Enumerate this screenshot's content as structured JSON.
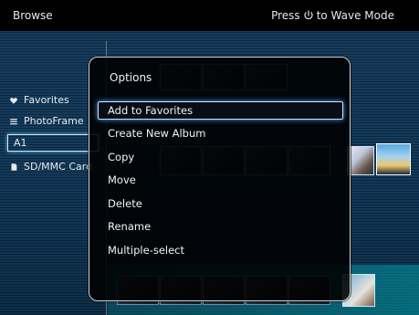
{
  "topbar": {
    "title": "Browse",
    "mode_prefix": "Press",
    "mode_suffix": "to Wave Mode"
  },
  "sidebar": {
    "items": [
      {
        "label": "Favorites",
        "icon": "heart-icon"
      },
      {
        "label": "PhotoFrame",
        "icon": "list-icon"
      },
      {
        "label": "A1",
        "icon": ""
      },
      {
        "label": "SD/MMC Card",
        "icon": "card-icon"
      }
    ]
  },
  "options": {
    "title": "Options",
    "items": [
      "Add to Favorites",
      "Create New Album",
      "Copy",
      "Move",
      "Delete",
      "Rename",
      "Multiple-select"
    ]
  }
}
